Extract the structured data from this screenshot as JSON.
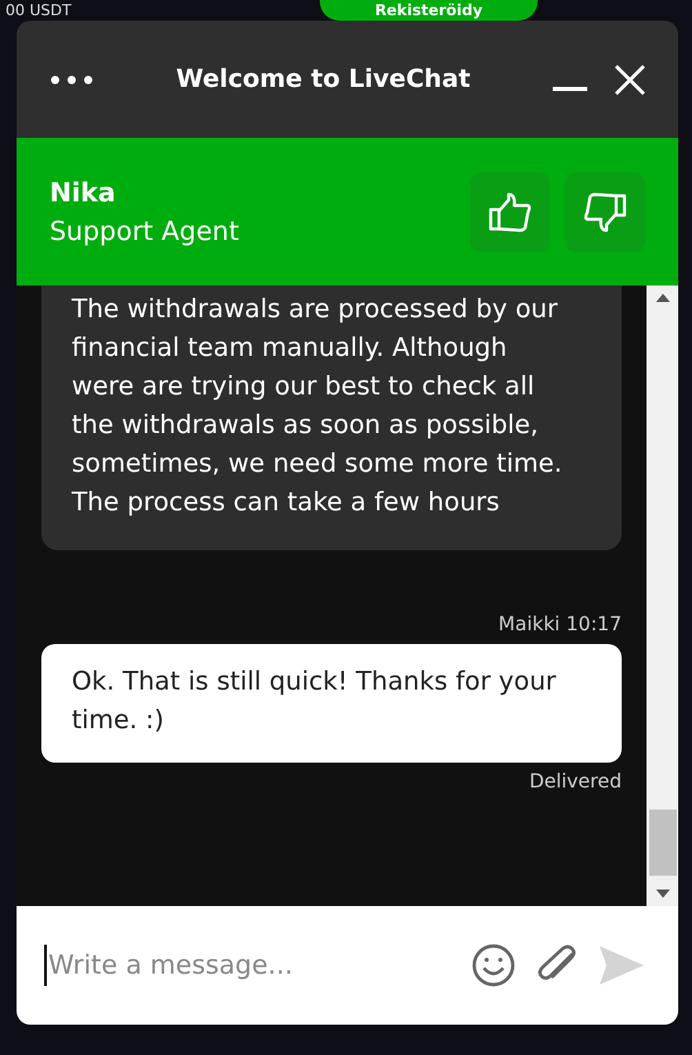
{
  "background": {
    "balance": "00 USDT",
    "register_button": "Rekisteröidy"
  },
  "window": {
    "title": "Welcome to LiveChat"
  },
  "agent": {
    "name": "Nika",
    "role": "Support Agent"
  },
  "messages": [
    {
      "kind": "agent",
      "text": "The withdrawals are processed by our financial team manually. Although were are trying our best to check all the withdrawals as soon as possible, sometimes, we need some more time. The process can take a few hours"
    },
    {
      "kind": "meta",
      "text": "Maikki 10:17"
    },
    {
      "kind": "visitor",
      "text": "Ok. That is still quick! Thanks for your time. :)"
    },
    {
      "kind": "status",
      "text": "Delivered"
    }
  ],
  "composer": {
    "placeholder": "Write a message..."
  }
}
